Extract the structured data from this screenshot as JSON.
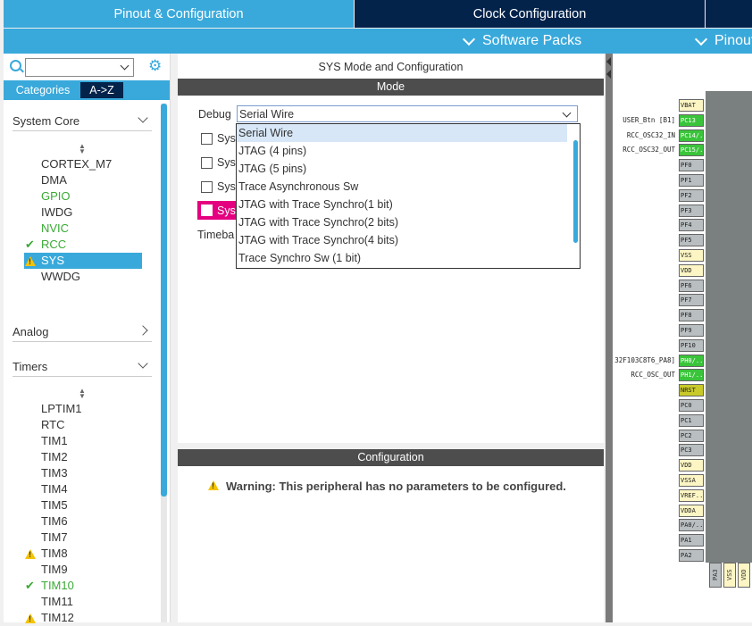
{
  "tabs": {
    "pinout": "Pinout & Configuration",
    "clock": "Clock Configuration"
  },
  "submenu": {
    "software_packs": "Software Packs",
    "pinout": "Pinout"
  },
  "left": {
    "search_value": "",
    "categories_tab": "Categories",
    "az_tab": "A->Z",
    "system_core": {
      "title": "System Core",
      "items": [
        "CORTEX_M7",
        "DMA",
        "GPIO",
        "IWDG",
        "NVIC",
        "RCC",
        "SYS",
        "WWDG"
      ]
    },
    "analog": {
      "title": "Analog"
    },
    "timers": {
      "title": "Timers",
      "items": [
        "LPTIM1",
        "RTC",
        "TIM1",
        "TIM2",
        "TIM3",
        "TIM4",
        "TIM5",
        "TIM6",
        "TIM7",
        "TIM8",
        "TIM9",
        "TIM10",
        "TIM11",
        "TIM12"
      ]
    }
  },
  "center": {
    "title": "SYS Mode and Configuration",
    "mode_header": "Mode",
    "debug_label": "Debug",
    "debug_value": "Serial Wire",
    "checkbox_labels": [
      "Sys",
      "Sys",
      "Sys",
      "Sys"
    ],
    "timebase_label": "Timeba",
    "dropdown_options": [
      "Serial Wire",
      "JTAG (4 pins)",
      "JTAG (5 pins)",
      "Trace Asynchronous Sw",
      "JTAG with Trace Synchro(1 bit)",
      "JTAG with Trace Synchro(2 bits)",
      "JTAG with Trace Synchro(4 bits)",
      "Trace Synchro Sw (1 bit)"
    ],
    "config_header": "Configuration",
    "warning": "Warning: This peripheral has no parameters to be configured."
  },
  "chip": {
    "pins": [
      {
        "name": "VBAT",
        "style": "yellow-light"
      },
      {
        "name": "PC13",
        "style": "green",
        "label": "USER_Btn [B1]"
      },
      {
        "name": "PC14/..",
        "style": "green",
        "label": "RCC_OSC32_IN"
      },
      {
        "name": "PC15/..",
        "style": "green",
        "label": "RCC_OSC32_OUT"
      },
      {
        "name": "PF0",
        "style": "grey"
      },
      {
        "name": "PF1",
        "style": "grey"
      },
      {
        "name": "PF2",
        "style": "grey"
      },
      {
        "name": "PF3",
        "style": "grey"
      },
      {
        "name": "PF4",
        "style": "grey"
      },
      {
        "name": "PF5",
        "style": "grey"
      },
      {
        "name": "VSS",
        "style": "yellow-light"
      },
      {
        "name": "VDD",
        "style": "yellow-light"
      },
      {
        "name": "PF6",
        "style": "grey"
      },
      {
        "name": "PF7",
        "style": "grey"
      },
      {
        "name": "PF8",
        "style": "grey"
      },
      {
        "name": "PF9",
        "style": "grey"
      },
      {
        "name": "PF10",
        "style": "grey"
      },
      {
        "name": "PH0/..",
        "style": "green",
        "label": "32F103C8T6_PA8]"
      },
      {
        "name": "PH1/..",
        "style": "green",
        "label": "RCC_OSC_OUT"
      },
      {
        "name": "NRST",
        "style": "olive"
      },
      {
        "name": "PC0",
        "style": "grey"
      },
      {
        "name": "PC1",
        "style": "grey"
      },
      {
        "name": "PC2",
        "style": "grey"
      },
      {
        "name": "PC3",
        "style": "grey"
      },
      {
        "name": "VDD",
        "style": "yellow-light"
      },
      {
        "name": "VSSA",
        "style": "yellow-light"
      },
      {
        "name": "VREF..",
        "style": "yellow-light"
      },
      {
        "name": "VDDA",
        "style": "yellow-light"
      },
      {
        "name": "PA0/..",
        "style": "grey"
      },
      {
        "name": "PA1",
        "style": "grey"
      },
      {
        "name": "PA2",
        "style": "grey"
      }
    ],
    "bottom_pins": [
      {
        "name": "PA3",
        "style": "grey"
      },
      {
        "name": "VSS",
        "style": "yellow-light"
      },
      {
        "name": "VDD",
        "style": "yellow-light"
      }
    ]
  },
  "colors": {
    "accent": "#39a9db",
    "dark_navy": "#03234b",
    "status_green": "#3aaa35",
    "warning_yellow": "#f5c400",
    "pink": "#e4007f"
  }
}
